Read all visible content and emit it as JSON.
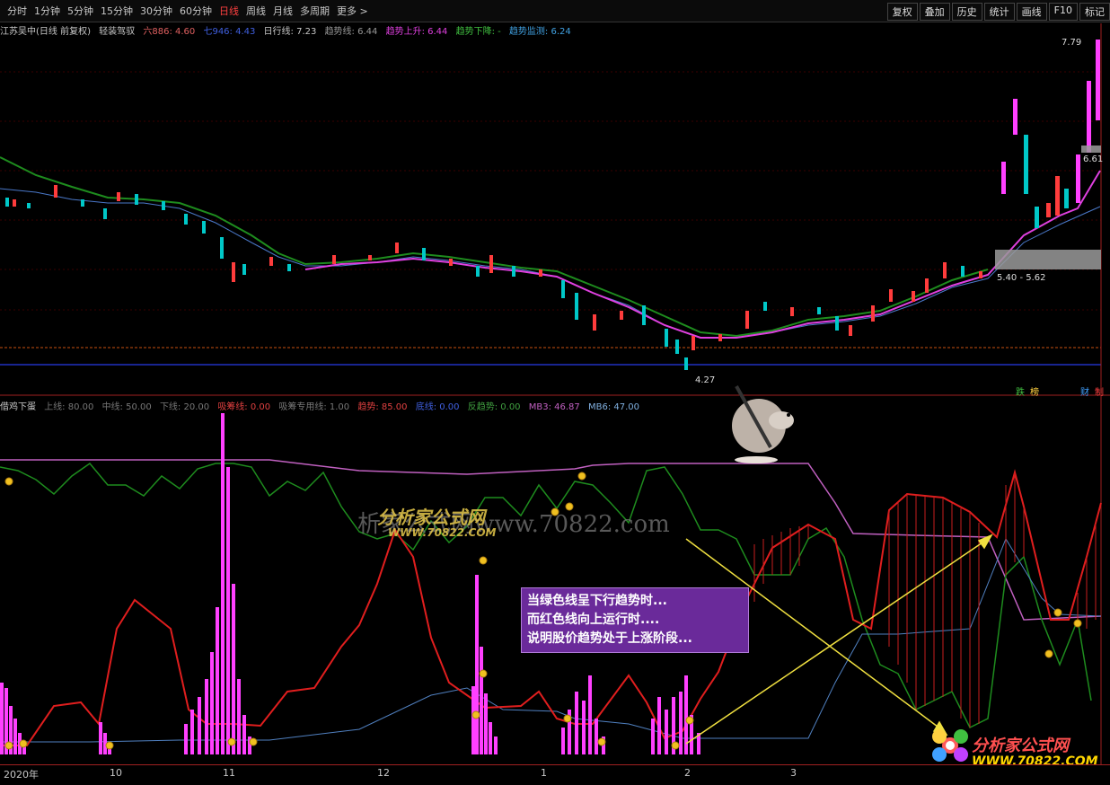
{
  "periods": [
    "分时",
    "1分钟",
    "5分钟",
    "15分钟",
    "30分钟",
    "60分钟",
    "日线",
    "周线",
    "月线",
    "多周期",
    "更多 >"
  ],
  "active_period": "日线",
  "right_tools": [
    "复权",
    "叠加",
    "历史",
    "统计",
    "画线",
    "F10",
    "标记"
  ],
  "main_info": {
    "stock": "江苏吴中(日线 前复权)",
    "indicator": "轻装驾驭",
    "v1": "六886: 4.60",
    "v2": "七946: 4.43",
    "v3": "日行线: 7.23",
    "v4": "趋势线: 6.44",
    "v5": "趋势上升: 6.44",
    "v6": "趋势下降: -",
    "v7": "趋势监测: 6.24"
  },
  "sub_info": {
    "name": "借鸡下蛋",
    "p1": "上线: 80.00",
    "p2": "中线: 50.00",
    "p3": "下线: 20.00",
    "p4": "吸筹线: 0.00",
    "p5": "吸筹专用线: 1.00",
    "p6": "趋势: 85.00",
    "p7": "底线: 0.00",
    "p8": "反趋势: 0.00",
    "p9": "MB3: 46.87",
    "p10": "MB6: 47.00"
  },
  "price_labels": {
    "high": "7.79",
    "right": "6.61",
    "band": "5.40 - 5.62",
    "low": "4.27"
  },
  "mini_buttons": [
    "跌",
    "榜",
    "财",
    "制"
  ],
  "xaxis": [
    "2020年",
    "10",
    "11",
    "12",
    "1",
    "2",
    "3"
  ],
  "tip_lines": [
    "当绿色线呈下行趋势时...",
    "而红色线向上运行时....",
    "说明股价趋势处于上涨阶段..."
  ],
  "watermark": {
    "main": "分析家公式网",
    "url": "WWW.70822.COM",
    "url_small": "www.70822.com",
    "url_big": "析家公式网www.70822.com"
  },
  "colors": {
    "up": "#ff3c3c",
    "down": "#00c8c8",
    "ma_green": "#1e8c1e",
    "ma_magenta": "#e040e0",
    "ma_blue": "#4a78c8",
    "red_line": "#e01e1e",
    "purple_line": "#c060c0",
    "blue_line": "#5080c0",
    "pink_bar": "#ff40ff"
  }
}
